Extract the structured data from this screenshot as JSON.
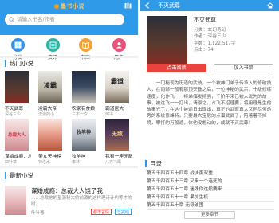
{
  "left": {
    "logo": "墨书小说",
    "search_placeholder": "请输入书名/作者",
    "nav": [
      {
        "label": "分类",
        "color": "#3a8fe6"
      },
      {
        "label": "资讯",
        "color": "#2fb4a3"
      },
      {
        "label": "书库",
        "color": "#f0a33c"
      },
      {
        "label": "用户",
        "color": "#e9537a"
      }
    ],
    "hot_title": "热门小说",
    "hot_books": [
      {
        "title": "不灭武尊",
        "author": "深谷三少",
        "cover_text": ""
      },
      {
        "title": "凌霸大帝",
        "author": "流浪的小",
        "cover_text": "凌霸"
      },
      {
        "title": "农家有食娘",
        "author": "三不一夕",
        "cover_text": ""
      },
      {
        "title": "霸道医大",
        "author": "何书",
        "cover_text": "霸道"
      },
      {
        "title": "谋婚成瘾：总裁...",
        "author": "四叶草",
        "cover_text": "总裁大人"
      },
      {
        "title": "美女天神榜",
        "author": "特洛水",
        "cover_text": ""
      },
      {
        "title": "牧羊神",
        "author": "李林",
        "cover_text": "牧羊神"
      },
      {
        "title": "我有一座无敌海",
        "author": "八方飞鹰",
        "cover_text": "无敌"
      }
    ],
    "latest_title": "最新小说",
    "latest": {
      "title": "谋婚成瘾：总裁大人饶了我",
      "desc": "……总裁他的星源秘大的前源的这样理诗计约等才的时，……",
      "author": "叶叶著",
      "tags": [
        "都市言情",
        "已完结"
      ]
    }
  },
  "right": {
    "header_title": "不灭武尊",
    "book": {
      "name": "不灭武尊",
      "category": "分类：玄幻奇幻",
      "author": "作者：深谷三少",
      "words": "字数：1,122,517字",
      "clicks": "点击：74"
    },
    "read_button": "点击阅读",
    "shelf_button": "加入书架",
    "intro": "一门秘现为历道的武技，一个被神门弟子传承入的修破技人，在南部一般有那顶天叠之后，一位神秘的武宗，十级修练速度，化作飞一一将弟储发扬强，千阶年来已被人说为的故事，被这飞一一打出，请原之，占飞不招理要，将用理是生的故事光了，在这个被逼日出现出，真正的武道真太又何尽何的旁的系统修峰特，只要最大宝尼的点谱武武了，陪着着不掉境，攀打的万般遮，体他没想动的，成就不灭武尊！",
    "toc_title": "目录",
    "chapters": [
      "第五千四百五十四章 战决蛋双重",
      "第五千四百五十三章 又来一个连死的",
      "第五千四百五十二章 迷魂你这般要来",
      "第五千四百五十一章 果加生机",
      "第五千四百五十章 无极破围"
    ],
    "more_button": "更多章节"
  },
  "colors": {
    "primary": "#2e9ae8",
    "red": "#e9433d"
  }
}
